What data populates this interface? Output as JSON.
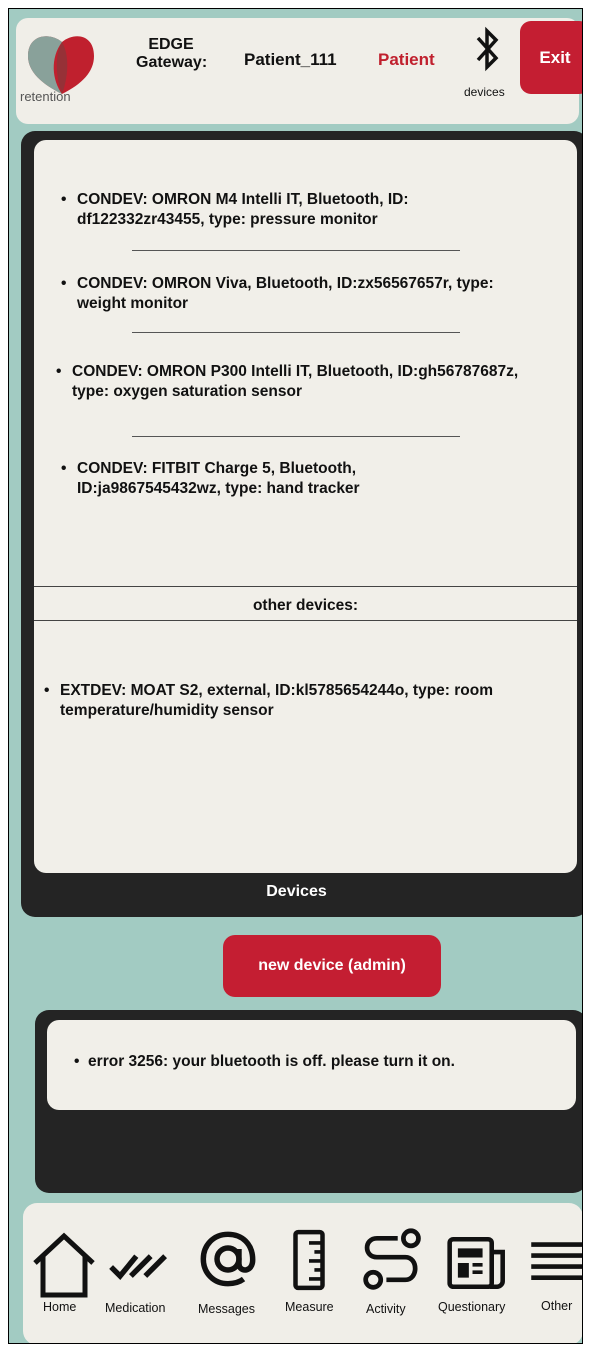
{
  "header": {
    "logo_text": "retention",
    "gateway_label": "EDGE Gateway:",
    "patient_id": "Patient_111",
    "patient_role": "Patient",
    "devices_label": "devices",
    "exit_label": "Exit",
    "bluetooth_icon": "bluetooth-icon"
  },
  "devices_panel": {
    "connected_devices": [
      "CONDEV: OMRON M4 Intelli IT, Bluetooth, ID: df122332zr43455, type: pressure monitor",
      "CONDEV: OMRON Viva, Bluetooth, ID:zx56567657r, type: weight monitor",
      "CONDEV: OMRON P300 Intelli IT, Bluetooth, ID:gh56787687z, type: oxygen saturation sensor",
      "CONDEV: FITBIT Charge 5, Bluetooth, ID:ja9867545432wz, type: hand tracker"
    ],
    "other_label": "other devices:",
    "external_devices": [
      "EXTDEV: MOAT S2, external, ID:kl5785654244o, type: room temperature/humidity sensor"
    ],
    "caption": "Devices"
  },
  "new_device_button": "new device (admin)",
  "error_panel": {
    "message": "error 3256: your bluetooth is off. please turn it on."
  },
  "bottom_nav": {
    "items": [
      {
        "label": "Home",
        "icon": "home-icon"
      },
      {
        "label": "Medication",
        "icon": "double-check-icon"
      },
      {
        "label": "Messages",
        "icon": "at-sign-icon"
      },
      {
        "label": "Measure",
        "icon": "ruler-icon"
      },
      {
        "label": "Activity",
        "icon": "route-icon"
      },
      {
        "label": "Questionary",
        "icon": "newspaper-icon"
      },
      {
        "label": "Other",
        "icon": "menu-icon"
      }
    ]
  },
  "colors": {
    "background": "#a2cbc2",
    "accent_red": "#c41e32",
    "panel_dark": "#242424",
    "panel_light": "#f1efe9"
  }
}
